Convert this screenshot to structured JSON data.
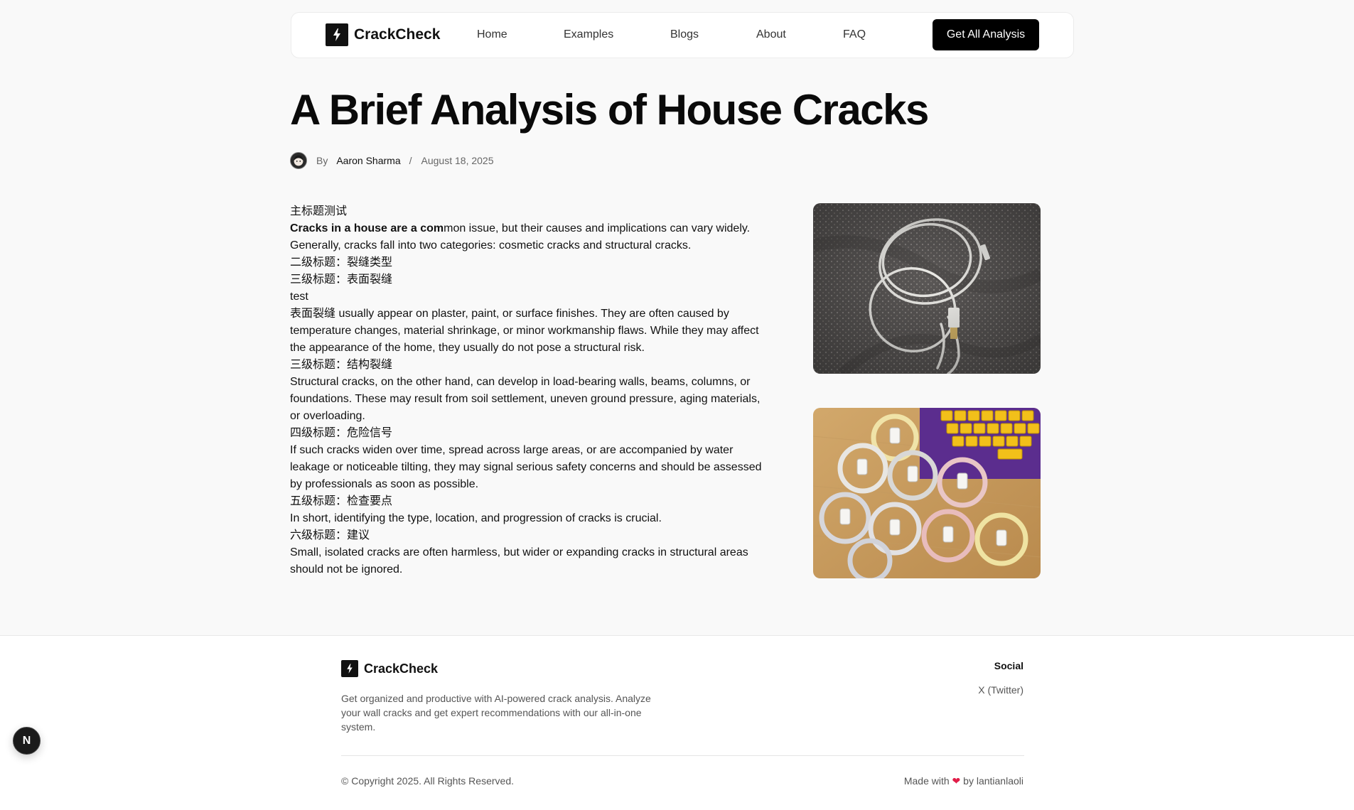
{
  "nav": {
    "brand": "CrackCheck",
    "links": [
      "Home",
      "Examples",
      "Blogs",
      "About",
      "FAQ"
    ],
    "cta": "Get All Analysis"
  },
  "post": {
    "title": "A Brief Analysis of House Cracks",
    "by": "By",
    "author": "Aaron Sharma",
    "separator": "/",
    "date": "August 18, 2025"
  },
  "article": {
    "lines": [
      "主标题测试",
      "",
      "Generally, cracks fall into two categories: cosmetic cracks and structural cracks.",
      "二级标题：裂缝类型",
      "三级标题：表面裂缝",
      "test",
      "表面裂缝 usually appear on plaster, paint, or surface finishes. They are often caused by temperature changes, material shrinkage, or minor workmanship flaws. While they may affect the appearance of the home, they usually do not pose a structural risk.",
      "三级标题：结构裂缝",
      "Structural cracks, on the other hand, can develop in load-bearing walls, beams, columns, or foundations. These may result from soil settlement, uneven ground pressure, aging materials, or overloading.",
      "四级标题：危险信号",
      "If such cracks widen over time, spread across large areas, or are accompanied by water leakage or noticeable tilting, they may signal serious safety concerns and should be assessed by professionals as soon as possible.",
      "五级标题：检查要点",
      "In short, identifying the type, location, and progression of cracks is crucial.",
      "六级标题：建议",
      "Small, isolated cracks are often harmless, but wider or expanding cracks in structural areas should not be ignored."
    ],
    "intro_bold": "Cracks in a house are a com",
    "intro_rest": "mon issue, but their causes and implications can vary widely."
  },
  "footer": {
    "brand": "CrackCheck",
    "description": "Get organized and productive with AI-powered crack analysis. Analyze your wall cracks and get expert recommendations with our all-in-one system.",
    "social_title": "Social",
    "social_link": "X (Twitter)",
    "copyright": "© Copyright 2025. All Rights Reserved.",
    "made_prefix": "Made with",
    "heart": "❤",
    "made_suffix": "by lantianlaoli"
  },
  "floating_button": {
    "label": "N"
  },
  "colors": {
    "accent": "#000000",
    "heart": "#e11d48",
    "page_bg": "#f9f9f9"
  }
}
